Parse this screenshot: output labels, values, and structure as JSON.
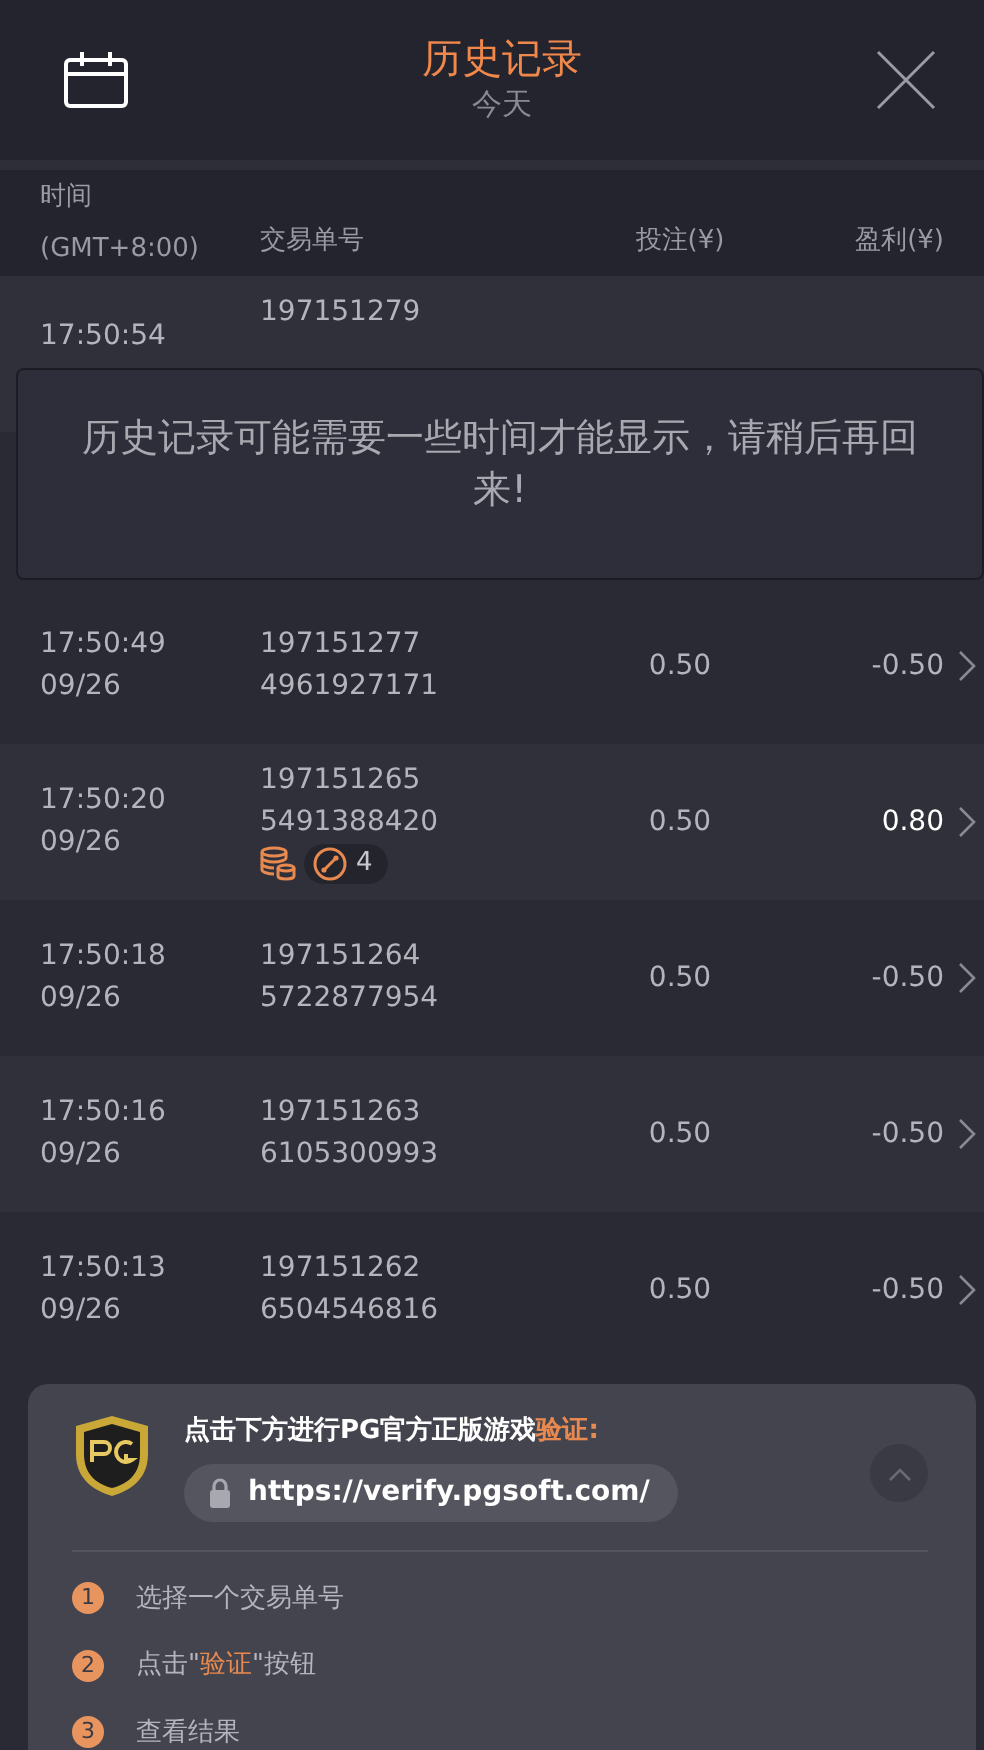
{
  "header": {
    "title": "历史记录",
    "subtitle": "今天"
  },
  "columns": [
    {
      "label": "时间",
      "sub": "(GMT+8:00)"
    },
    {
      "label": "交易单号"
    },
    {
      "label": "投注(¥)"
    },
    {
      "label": "盈利(¥)"
    }
  ],
  "rows": [
    {
      "time": "17:50:54",
      "order": "197151279"
    },
    {
      "time": "17:50:49",
      "date": "09/26",
      "order": "197151277",
      "order_2": "4961927171",
      "bet": "0.50",
      "profit": "-0.50",
      "win": false
    },
    {
      "time": "17:50:20",
      "date": "09/26",
      "order": "197151265",
      "order_2": "5491388420",
      "bet": "0.50",
      "profit": "0.80",
      "win": true,
      "badge": "4"
    },
    {
      "time": "17:50:18",
      "date": "09/26",
      "order": "197151264",
      "order_2": "5722877954",
      "bet": "0.50",
      "profit": "-0.50",
      "win": false
    },
    {
      "time": "17:50:16",
      "date": "09/26",
      "order": "197151263",
      "order_2": "6105300993",
      "bet": "0.50",
      "profit": "-0.50",
      "win": false
    },
    {
      "time": "17:50:13",
      "date": "09/26",
      "order": "197151262",
      "order_2": "6504546816",
      "bet": "0.50",
      "profit": "-0.50",
      "win": false
    }
  ],
  "toast": "历史记录可能需要一些时间才能显示，请稍后再回来!",
  "verify": {
    "heading": "点击下方进行PG官方正版游戏",
    "heading_accent": "验证:",
    "url": "https://verify.pgsoft.com/",
    "expanded": true,
    "steps": [
      {
        "number": "1",
        "text": "选择一个交易单号"
      },
      {
        "number": "2",
        "text": "点击\"",
        "accent": "验证",
        "after": "\"按钮"
      },
      {
        "number": "3",
        "text": "查看结果"
      }
    ]
  }
}
